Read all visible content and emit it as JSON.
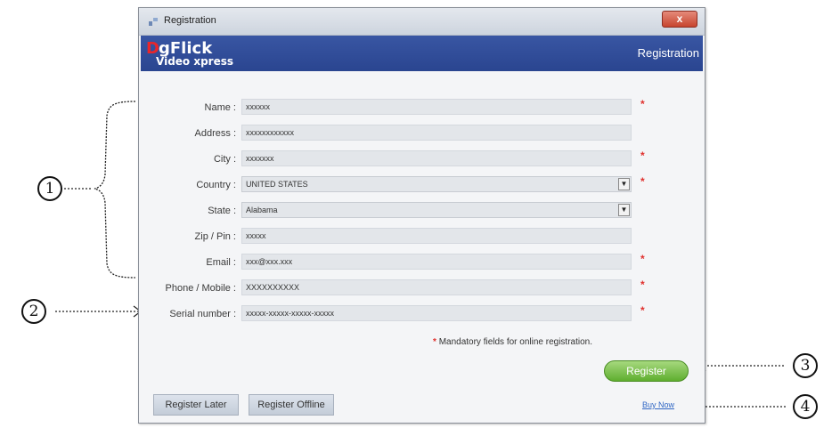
{
  "window": {
    "title": "Registration",
    "close_label": "x"
  },
  "banner": {
    "logo_first": "D",
    "logo_rest": "gFlick",
    "logo_sub": "Video xpress",
    "right_title": "Registration"
  },
  "form": {
    "fields": [
      {
        "label": "Name :",
        "value": "xxxxxx",
        "required": true,
        "type": "text"
      },
      {
        "label": "Address :",
        "value": "xxxxxxxxxxxx",
        "required": false,
        "type": "text"
      },
      {
        "label": "City :",
        "value": "xxxxxxx",
        "required": true,
        "type": "text"
      },
      {
        "label": "Country :",
        "value": "UNITED STATES",
        "required": true,
        "type": "select"
      },
      {
        "label": "State :",
        "value": "Alabama",
        "required": false,
        "type": "select"
      },
      {
        "label": "Zip / Pin :",
        "value": "xxxxx",
        "required": false,
        "type": "text"
      },
      {
        "label": "Email :",
        "value": "xxx@xxx.xxx",
        "required": true,
        "type": "text"
      },
      {
        "label": "Phone / Mobile :",
        "value": "XXXXXXXXXX",
        "required": true,
        "type": "text"
      },
      {
        "label": "Serial number :",
        "value": "xxxxx-xxxxx-xxxxx-xxxxx",
        "required": true,
        "type": "text"
      }
    ],
    "required_mark": "*",
    "mandatory_note": "Mandatory fields for online registration."
  },
  "buttons": {
    "register": "Register",
    "register_later": "Register Later",
    "register_offline": "Register Offline",
    "buy_now": "Buy Now"
  },
  "annotations": [
    "1",
    "2",
    "3",
    "4"
  ],
  "colors": {
    "banner": "#2f4c99",
    "required": "#e0312e",
    "register_button": "#6fbf3a",
    "logo_red": "#e8262b"
  }
}
